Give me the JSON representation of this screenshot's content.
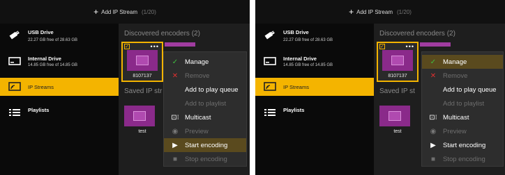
{
  "screens": [
    {
      "topbar": {
        "add_label": "Add IP Stream",
        "count": "(1/20)"
      },
      "sidebar": [
        {
          "label": "USB Drive",
          "detail": "22.27 GB free of 28.63 GB",
          "icon": "usb-drive-icon"
        },
        {
          "label": "Internal Drive",
          "detail": "14.85 GB free of 14.85 GB",
          "icon": "internal-drive-icon"
        },
        {
          "label": "IP Streams",
          "detail": "",
          "icon": "ip-streams-icon",
          "active": true
        },
        {
          "label": "Playlists",
          "detail": "",
          "icon": "playlists-icon"
        }
      ],
      "discovered_title": "Discovered encoders",
      "discovered_count": "(2)",
      "saved_title": "Saved IP str",
      "encoder_tile": {
        "label": "8107137"
      },
      "saved_tile": {
        "label": "test"
      },
      "menu": [
        {
          "label": "Manage",
          "icon": "check",
          "disabled": false,
          "highlighted": false
        },
        {
          "label": "Remove",
          "icon": "x",
          "disabled": true,
          "highlighted": false
        },
        {
          "label": "Add to play queue",
          "icon": "",
          "disabled": false,
          "highlighted": false
        },
        {
          "label": "Add to playlist",
          "icon": "",
          "disabled": true,
          "highlighted": false
        },
        {
          "label": "Multicast",
          "icon": "multicast",
          "disabled": false,
          "highlighted": false
        },
        {
          "label": "Preview",
          "icon": "eye",
          "disabled": true,
          "highlighted": false
        },
        {
          "label": "Start encoding",
          "icon": "play",
          "disabled": false,
          "highlighted": true
        },
        {
          "label": "Stop encoding",
          "icon": "stop",
          "disabled": true,
          "highlighted": false
        }
      ]
    },
    {
      "topbar": {
        "add_label": "Add IP Stream",
        "count": "(1/20)"
      },
      "sidebar": [
        {
          "label": "USB Drive",
          "detail": "22.27 GB free of 28.63 GB",
          "icon": "usb-drive-icon"
        },
        {
          "label": "Internal Drive",
          "detail": "14.85 GB free of 14.85 GB",
          "icon": "internal-drive-icon"
        },
        {
          "label": "IP Streams",
          "detail": "",
          "icon": "ip-streams-icon",
          "active": true
        },
        {
          "label": "Playlists",
          "detail": "",
          "icon": "playlists-icon"
        }
      ],
      "discovered_title": "Discovered encoders",
      "discovered_count": "(2)",
      "saved_title": "Saved IP st",
      "encoder_tile": {
        "label": "8107137"
      },
      "saved_tile": {
        "label": "test"
      },
      "menu": [
        {
          "label": "Manage",
          "icon": "check",
          "disabled": false,
          "highlighted": true
        },
        {
          "label": "Remove",
          "icon": "x",
          "disabled": true,
          "highlighted": false
        },
        {
          "label": "Add to play queue",
          "icon": "",
          "disabled": false,
          "highlighted": false
        },
        {
          "label": "Add to playlist",
          "icon": "",
          "disabled": true,
          "highlighted": false
        },
        {
          "label": "Multicast",
          "icon": "multicast",
          "disabled": false,
          "highlighted": false
        },
        {
          "label": "Preview",
          "icon": "eye",
          "disabled": true,
          "highlighted": false
        },
        {
          "label": "Start encoding",
          "icon": "play",
          "disabled": false,
          "highlighted": false
        },
        {
          "label": "Stop encoding",
          "icon": "stop",
          "disabled": true,
          "highlighted": false
        }
      ]
    }
  ],
  "colors": {
    "accent": "#f4b400",
    "panel_bg": "#1b1b1b",
    "sidebar_bg": "#0a0a0a",
    "tile_purple": "#8a2a8a",
    "menu_bg": "#2d2d2d",
    "highlight": "#5a4a1e"
  }
}
